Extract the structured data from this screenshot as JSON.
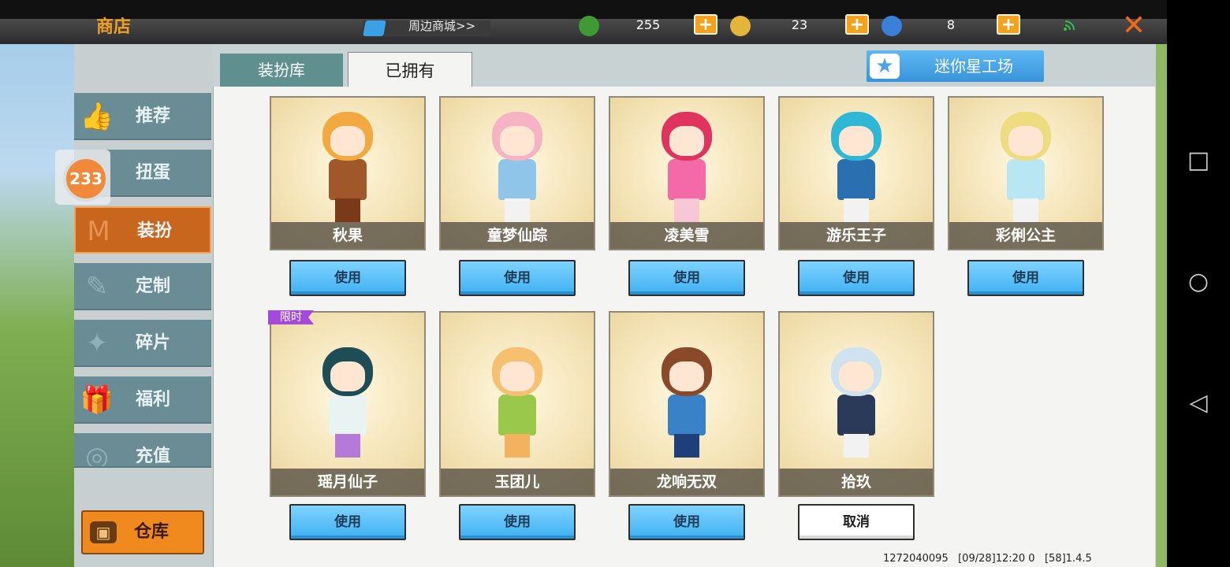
{
  "header": {
    "shop_title": "商店",
    "mall_link": "周边商城>>",
    "currencies": [
      {
        "icon": "mini-bean-icon",
        "value": "255",
        "color": "#3f9a33"
      },
      {
        "icon": "mini-coin-icon",
        "value": "23",
        "color": "#e3b53a"
      },
      {
        "icon": "star-coin-icon",
        "value": "8",
        "color": "#3a7fd8"
      }
    ],
    "plus_label": "+",
    "close_label": "✕"
  },
  "tabs": {
    "library": "装扮库",
    "owned": "已拥有"
  },
  "mini_factory": {
    "label": "迷你星工场",
    "star": "★"
  },
  "sidebar": {
    "badge": "233",
    "items": [
      {
        "label": "推荐",
        "icon": "thumbs-up-icon",
        "glyph": "👍"
      },
      {
        "label": "扭蛋",
        "icon": "capsule-icon",
        "glyph": "●"
      },
      {
        "label": "装扮",
        "icon": "shirt-icon",
        "glyph": "M"
      },
      {
        "label": "定制",
        "icon": "pencil-icon",
        "glyph": "✎"
      },
      {
        "label": "碎片",
        "icon": "puzzle-icon",
        "glyph": "✦"
      },
      {
        "label": "福利",
        "icon": "gift-icon",
        "glyph": "🎁"
      },
      {
        "label": "充值",
        "icon": "coin-stack-icon",
        "glyph": "◎"
      }
    ],
    "warehouse": "仓库",
    "warehouse_glyph": "▣"
  },
  "cards": [
    {
      "name": "秋果",
      "action": "使用",
      "hair": "#f2a940",
      "outfit": "#a0582a",
      "legs": "#7a3a1a"
    },
    {
      "name": "童梦仙踪",
      "action": "使用",
      "hair": "#f6b3c3",
      "outfit": "#8ec5e8",
      "legs": "#f2f2f2"
    },
    {
      "name": "凌美雪",
      "action": "使用",
      "hair": "#e0345f",
      "outfit": "#f46aa8",
      "legs": "#f7c7d8"
    },
    {
      "name": "游乐王子",
      "action": "使用",
      "hair": "#2fb8d6",
      "outfit": "#2a6fb0",
      "legs": "#f2f2f2"
    },
    {
      "name": "彩俐公主",
      "action": "使用",
      "hair": "#eddc80",
      "outfit": "#b8e6f2",
      "legs": "#f2f2f2"
    },
    {
      "name": "瑶月仙子",
      "action": "使用",
      "hair": "#1f4d56",
      "outfit": "#e9f4f2",
      "legs": "#b57ad8",
      "badge": "限时"
    },
    {
      "name": "玉团儿",
      "action": "使用",
      "hair": "#f7c070",
      "outfit": "#9ac84a",
      "legs": "#f2b260"
    },
    {
      "name": "龙响无双",
      "action": "使用",
      "hair": "#8a4a2a",
      "outfit": "#3a82c8",
      "legs": "#1f3f7a"
    },
    {
      "name": "拾玖",
      "action": "取消",
      "hair": "#cfe2ef",
      "outfit": "#2c3a5a",
      "legs": "#f2f2f2"
    }
  ],
  "footer": "1272040095   [09/28]12:20 0   [58]1.4.5",
  "android_nav": {
    "square": "□",
    "circle": "○",
    "back": "◁"
  }
}
